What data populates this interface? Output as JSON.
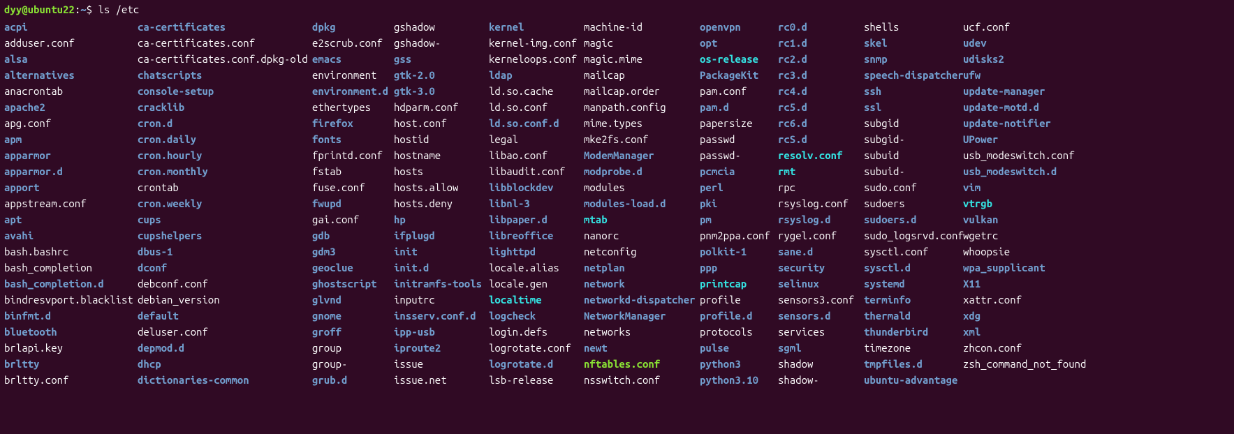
{
  "prompt": {
    "user_host": "dyy@ubuntu22",
    "colon": ":",
    "path": "~",
    "dollar": "$",
    "command": "ls /etc"
  },
  "columns": [
    [
      {
        "name": "acpi",
        "cls": "dir"
      },
      {
        "name": "adduser.conf",
        "cls": "file"
      },
      {
        "name": "alsa",
        "cls": "dir"
      },
      {
        "name": "alternatives",
        "cls": "dir"
      },
      {
        "name": "anacrontab",
        "cls": "file"
      },
      {
        "name": "apache2",
        "cls": "dir"
      },
      {
        "name": "apg.conf",
        "cls": "file"
      },
      {
        "name": "apm",
        "cls": "dir"
      },
      {
        "name": "apparmor",
        "cls": "dir"
      },
      {
        "name": "apparmor.d",
        "cls": "dir"
      },
      {
        "name": "apport",
        "cls": "dir"
      },
      {
        "name": "appstream.conf",
        "cls": "file"
      },
      {
        "name": "apt",
        "cls": "dir"
      },
      {
        "name": "avahi",
        "cls": "dir"
      },
      {
        "name": "bash.bashrc",
        "cls": "file"
      },
      {
        "name": "bash_completion",
        "cls": "file"
      },
      {
        "name": "bash_completion.d",
        "cls": "dir"
      },
      {
        "name": "bindresvport.blacklist",
        "cls": "file"
      },
      {
        "name": "binfmt.d",
        "cls": "dir"
      },
      {
        "name": "bluetooth",
        "cls": "dir"
      },
      {
        "name": "brlapi.key",
        "cls": "file"
      },
      {
        "name": "brltty",
        "cls": "dir"
      },
      {
        "name": "brltty.conf",
        "cls": "file"
      }
    ],
    [
      {
        "name": "ca-certificates",
        "cls": "dir"
      },
      {
        "name": "ca-certificates.conf",
        "cls": "file"
      },
      {
        "name": "ca-certificates.conf.dpkg-old",
        "cls": "file"
      },
      {
        "name": "chatscripts",
        "cls": "dir"
      },
      {
        "name": "console-setup",
        "cls": "dir"
      },
      {
        "name": "cracklib",
        "cls": "dir"
      },
      {
        "name": "cron.d",
        "cls": "dir"
      },
      {
        "name": "cron.daily",
        "cls": "dir"
      },
      {
        "name": "cron.hourly",
        "cls": "dir"
      },
      {
        "name": "cron.monthly",
        "cls": "dir"
      },
      {
        "name": "crontab",
        "cls": "file"
      },
      {
        "name": "cron.weekly",
        "cls": "dir"
      },
      {
        "name": "cups",
        "cls": "dir"
      },
      {
        "name": "cupshelpers",
        "cls": "dir"
      },
      {
        "name": "dbus-1",
        "cls": "dir"
      },
      {
        "name": "dconf",
        "cls": "dir"
      },
      {
        "name": "debconf.conf",
        "cls": "file"
      },
      {
        "name": "debian_version",
        "cls": "file"
      },
      {
        "name": "default",
        "cls": "dir"
      },
      {
        "name": "deluser.conf",
        "cls": "file"
      },
      {
        "name": "depmod.d",
        "cls": "dir"
      },
      {
        "name": "dhcp",
        "cls": "dir"
      },
      {
        "name": "dictionaries-common",
        "cls": "dir"
      }
    ],
    [
      {
        "name": "dpkg",
        "cls": "dir"
      },
      {
        "name": "e2scrub.conf",
        "cls": "file"
      },
      {
        "name": "emacs",
        "cls": "dir"
      },
      {
        "name": "environment",
        "cls": "file"
      },
      {
        "name": "environment.d",
        "cls": "dir"
      },
      {
        "name": "ethertypes",
        "cls": "file"
      },
      {
        "name": "firefox",
        "cls": "dir"
      },
      {
        "name": "fonts",
        "cls": "dir"
      },
      {
        "name": "fprintd.conf",
        "cls": "file"
      },
      {
        "name": "fstab",
        "cls": "file"
      },
      {
        "name": "fuse.conf",
        "cls": "file"
      },
      {
        "name": "fwupd",
        "cls": "dir"
      },
      {
        "name": "gai.conf",
        "cls": "file"
      },
      {
        "name": "gdb",
        "cls": "dir"
      },
      {
        "name": "gdm3",
        "cls": "dir"
      },
      {
        "name": "geoclue",
        "cls": "dir"
      },
      {
        "name": "ghostscript",
        "cls": "dir"
      },
      {
        "name": "glvnd",
        "cls": "dir"
      },
      {
        "name": "gnome",
        "cls": "dir"
      },
      {
        "name": "groff",
        "cls": "dir"
      },
      {
        "name": "group",
        "cls": "file"
      },
      {
        "name": "group-",
        "cls": "file"
      },
      {
        "name": "grub.d",
        "cls": "dir"
      }
    ],
    [
      {
        "name": "gshadow",
        "cls": "file"
      },
      {
        "name": "gshadow-",
        "cls": "file"
      },
      {
        "name": "gss",
        "cls": "dir"
      },
      {
        "name": "gtk-2.0",
        "cls": "dir"
      },
      {
        "name": "gtk-3.0",
        "cls": "dir"
      },
      {
        "name": "hdparm.conf",
        "cls": "file"
      },
      {
        "name": "host.conf",
        "cls": "file"
      },
      {
        "name": "hostid",
        "cls": "file"
      },
      {
        "name": "hostname",
        "cls": "file"
      },
      {
        "name": "hosts",
        "cls": "file"
      },
      {
        "name": "hosts.allow",
        "cls": "file"
      },
      {
        "name": "hosts.deny",
        "cls": "file"
      },
      {
        "name": "hp",
        "cls": "dir"
      },
      {
        "name": "ifplugd",
        "cls": "dir"
      },
      {
        "name": "init",
        "cls": "dir"
      },
      {
        "name": "init.d",
        "cls": "dir"
      },
      {
        "name": "initramfs-tools",
        "cls": "dir"
      },
      {
        "name": "inputrc",
        "cls": "file"
      },
      {
        "name": "insserv.conf.d",
        "cls": "dir"
      },
      {
        "name": "ipp-usb",
        "cls": "dir"
      },
      {
        "name": "iproute2",
        "cls": "dir"
      },
      {
        "name": "issue",
        "cls": "file"
      },
      {
        "name": "issue.net",
        "cls": "file"
      }
    ],
    [
      {
        "name": "kernel",
        "cls": "dir"
      },
      {
        "name": "kernel-img.conf",
        "cls": "file"
      },
      {
        "name": "kerneloops.conf",
        "cls": "file"
      },
      {
        "name": "ldap",
        "cls": "dir"
      },
      {
        "name": "ld.so.cache",
        "cls": "file"
      },
      {
        "name": "ld.so.conf",
        "cls": "file"
      },
      {
        "name": "ld.so.conf.d",
        "cls": "dir"
      },
      {
        "name": "legal",
        "cls": "file"
      },
      {
        "name": "libao.conf",
        "cls": "file"
      },
      {
        "name": "libaudit.conf",
        "cls": "file"
      },
      {
        "name": "libblockdev",
        "cls": "dir"
      },
      {
        "name": "libnl-3",
        "cls": "dir"
      },
      {
        "name": "libpaper.d",
        "cls": "dir"
      },
      {
        "name": "libreoffice",
        "cls": "dir"
      },
      {
        "name": "lighttpd",
        "cls": "dir"
      },
      {
        "name": "locale.alias",
        "cls": "file"
      },
      {
        "name": "locale.gen",
        "cls": "file"
      },
      {
        "name": "localtime",
        "cls": "link"
      },
      {
        "name": "logcheck",
        "cls": "dir"
      },
      {
        "name": "login.defs",
        "cls": "file"
      },
      {
        "name": "logrotate.conf",
        "cls": "file"
      },
      {
        "name": "logrotate.d",
        "cls": "dir"
      },
      {
        "name": "lsb-release",
        "cls": "file"
      }
    ],
    [
      {
        "name": "machine-id",
        "cls": "file"
      },
      {
        "name": "magic",
        "cls": "file"
      },
      {
        "name": "magic.mime",
        "cls": "file"
      },
      {
        "name": "mailcap",
        "cls": "file"
      },
      {
        "name": "mailcap.order",
        "cls": "file"
      },
      {
        "name": "manpath.config",
        "cls": "file"
      },
      {
        "name": "mime.types",
        "cls": "file"
      },
      {
        "name": "mke2fs.conf",
        "cls": "file"
      },
      {
        "name": "ModemManager",
        "cls": "dir"
      },
      {
        "name": "modprobe.d",
        "cls": "dir"
      },
      {
        "name": "modules",
        "cls": "file"
      },
      {
        "name": "modules-load.d",
        "cls": "dir"
      },
      {
        "name": "mtab",
        "cls": "link"
      },
      {
        "name": "nanorc",
        "cls": "file"
      },
      {
        "name": "netconfig",
        "cls": "file"
      },
      {
        "name": "netplan",
        "cls": "dir"
      },
      {
        "name": "network",
        "cls": "dir"
      },
      {
        "name": "networkd-dispatcher",
        "cls": "dir"
      },
      {
        "name": "NetworkManager",
        "cls": "dir"
      },
      {
        "name": "networks",
        "cls": "file"
      },
      {
        "name": "newt",
        "cls": "dir"
      },
      {
        "name": "nftables.conf",
        "cls": "grn"
      },
      {
        "name": "nsswitch.conf",
        "cls": "file"
      }
    ],
    [
      {
        "name": "openvpn",
        "cls": "dir"
      },
      {
        "name": "opt",
        "cls": "dir"
      },
      {
        "name": "os-release",
        "cls": "link"
      },
      {
        "name": "PackageKit",
        "cls": "dir"
      },
      {
        "name": "pam.conf",
        "cls": "file"
      },
      {
        "name": "pam.d",
        "cls": "dir"
      },
      {
        "name": "papersize",
        "cls": "file"
      },
      {
        "name": "passwd",
        "cls": "file"
      },
      {
        "name": "passwd-",
        "cls": "file"
      },
      {
        "name": "pcmcia",
        "cls": "dir"
      },
      {
        "name": "perl",
        "cls": "dir"
      },
      {
        "name": "pki",
        "cls": "dir"
      },
      {
        "name": "pm",
        "cls": "dir"
      },
      {
        "name": "pnm2ppa.conf",
        "cls": "file"
      },
      {
        "name": "polkit-1",
        "cls": "dir"
      },
      {
        "name": "ppp",
        "cls": "dir"
      },
      {
        "name": "printcap",
        "cls": "link"
      },
      {
        "name": "profile",
        "cls": "file"
      },
      {
        "name": "profile.d",
        "cls": "dir"
      },
      {
        "name": "protocols",
        "cls": "file"
      },
      {
        "name": "pulse",
        "cls": "dir"
      },
      {
        "name": "python3",
        "cls": "dir"
      },
      {
        "name": "python3.10",
        "cls": "dir"
      }
    ],
    [
      {
        "name": "rc0.d",
        "cls": "dir"
      },
      {
        "name": "rc1.d",
        "cls": "dir"
      },
      {
        "name": "rc2.d",
        "cls": "dir"
      },
      {
        "name": "rc3.d",
        "cls": "dir"
      },
      {
        "name": "rc4.d",
        "cls": "dir"
      },
      {
        "name": "rc5.d",
        "cls": "dir"
      },
      {
        "name": "rc6.d",
        "cls": "dir"
      },
      {
        "name": "rcS.d",
        "cls": "dir"
      },
      {
        "name": "resolv.conf",
        "cls": "link"
      },
      {
        "name": "rmt",
        "cls": "link"
      },
      {
        "name": "rpc",
        "cls": "file"
      },
      {
        "name": "rsyslog.conf",
        "cls": "file"
      },
      {
        "name": "rsyslog.d",
        "cls": "dir"
      },
      {
        "name": "rygel.conf",
        "cls": "file"
      },
      {
        "name": "sane.d",
        "cls": "dir"
      },
      {
        "name": "security",
        "cls": "dir"
      },
      {
        "name": "selinux",
        "cls": "dir"
      },
      {
        "name": "sensors3.conf",
        "cls": "file"
      },
      {
        "name": "sensors.d",
        "cls": "dir"
      },
      {
        "name": "services",
        "cls": "file"
      },
      {
        "name": "sgml",
        "cls": "dir"
      },
      {
        "name": "shadow",
        "cls": "file"
      },
      {
        "name": "shadow-",
        "cls": "file"
      }
    ],
    [
      {
        "name": "shells",
        "cls": "file"
      },
      {
        "name": "skel",
        "cls": "dir"
      },
      {
        "name": "snmp",
        "cls": "dir"
      },
      {
        "name": "speech-dispatcher",
        "cls": "dir"
      },
      {
        "name": "ssh",
        "cls": "dir"
      },
      {
        "name": "ssl",
        "cls": "dir"
      },
      {
        "name": "subgid",
        "cls": "file"
      },
      {
        "name": "subgid-",
        "cls": "file"
      },
      {
        "name": "subuid",
        "cls": "file"
      },
      {
        "name": "subuid-",
        "cls": "file"
      },
      {
        "name": "sudo.conf",
        "cls": "file"
      },
      {
        "name": "sudoers",
        "cls": "file"
      },
      {
        "name": "sudoers.d",
        "cls": "dir"
      },
      {
        "name": "sudo_logsrvd.conf",
        "cls": "file"
      },
      {
        "name": "sysctl.conf",
        "cls": "file"
      },
      {
        "name": "sysctl.d",
        "cls": "dir"
      },
      {
        "name": "systemd",
        "cls": "dir"
      },
      {
        "name": "terminfo",
        "cls": "dir"
      },
      {
        "name": "thermald",
        "cls": "dir"
      },
      {
        "name": "thunderbird",
        "cls": "dir"
      },
      {
        "name": "timezone",
        "cls": "file"
      },
      {
        "name": "tmpfiles.d",
        "cls": "dir"
      },
      {
        "name": "ubuntu-advantage",
        "cls": "dir"
      }
    ],
    [
      {
        "name": "ucf.conf",
        "cls": "file"
      },
      {
        "name": "udev",
        "cls": "dir"
      },
      {
        "name": "udisks2",
        "cls": "dir"
      },
      {
        "name": "ufw",
        "cls": "dir"
      },
      {
        "name": "update-manager",
        "cls": "dir"
      },
      {
        "name": "update-motd.d",
        "cls": "dir"
      },
      {
        "name": "update-notifier",
        "cls": "dir"
      },
      {
        "name": "UPower",
        "cls": "dir"
      },
      {
        "name": "usb_modeswitch.conf",
        "cls": "file"
      },
      {
        "name": "usb_modeswitch.d",
        "cls": "dir"
      },
      {
        "name": "vim",
        "cls": "dir"
      },
      {
        "name": "vtrgb",
        "cls": "link"
      },
      {
        "name": "vulkan",
        "cls": "dir"
      },
      {
        "name": "wgetrc",
        "cls": "file"
      },
      {
        "name": "whoopsie",
        "cls": "file"
      },
      {
        "name": "wpa_supplicant",
        "cls": "dir"
      },
      {
        "name": "X11",
        "cls": "dir"
      },
      {
        "name": "xattr.conf",
        "cls": "file"
      },
      {
        "name": "xdg",
        "cls": "dir"
      },
      {
        "name": "xml",
        "cls": "dir"
      },
      {
        "name": "zhcon.conf",
        "cls": "file"
      },
      {
        "name": "zsh_command_not_found",
        "cls": "file"
      }
    ]
  ]
}
